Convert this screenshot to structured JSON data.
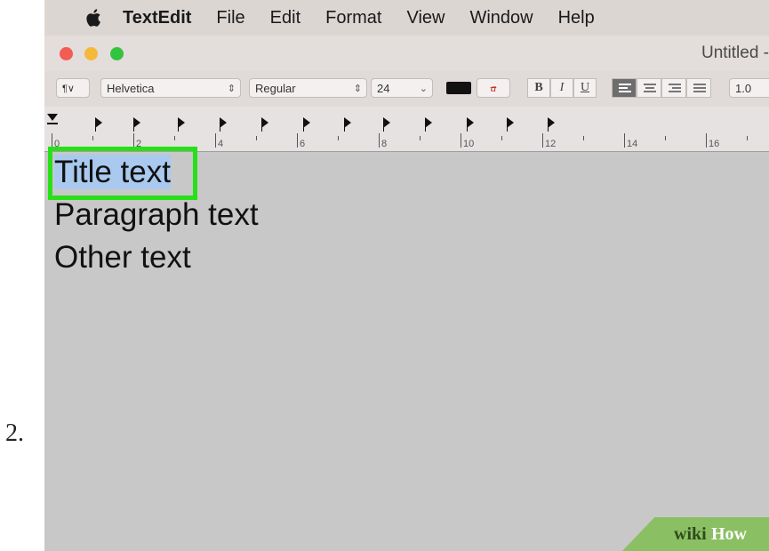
{
  "step_number": "2.",
  "menu_bar": {
    "app_name": "TextEdit",
    "items": [
      "File",
      "Edit",
      "Format",
      "View",
      "Window",
      "Help"
    ]
  },
  "window": {
    "title": "Untitled -"
  },
  "toolbar": {
    "paragraph_style": "¶∨",
    "font_family": "Helvetica",
    "font_style": "Regular",
    "font_size": "24",
    "bold_label": "B",
    "italic_label": "I",
    "underline_label": "U",
    "line_spacing": "1.0",
    "text_color": "#111111",
    "background_color_label": "a"
  },
  "ruler": {
    "numbers": [
      "0",
      "2",
      "4",
      "6",
      "8",
      "10",
      "12",
      "14",
      "16"
    ]
  },
  "document": {
    "lines": [
      "Title text",
      "Paragraph text",
      "Other text"
    ],
    "selected_line": "Title text"
  },
  "highlight_color": "#27e017",
  "selection_color": "#a9c9ef",
  "watermark": {
    "part1": "wiki",
    "part2": "How"
  }
}
